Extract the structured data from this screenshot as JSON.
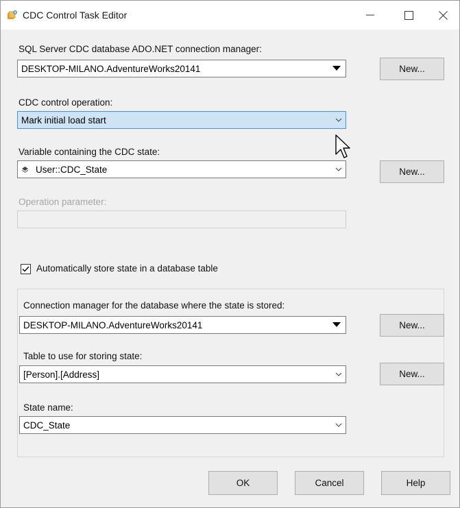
{
  "window": {
    "title": "CDC Control Task Editor"
  },
  "connection": {
    "label": "SQL Server CDC database ADO.NET connection manager:",
    "value": "DESKTOP-MILANO.AdventureWorks20141",
    "new_label": "New..."
  },
  "operation": {
    "label": "CDC control operation:",
    "value": "Mark initial load start"
  },
  "variable": {
    "label": "Variable containing the CDC state:",
    "value": "User::CDC_State",
    "new_label": "New..."
  },
  "parameter": {
    "label": "Operation parameter:",
    "value": ""
  },
  "auto_store": {
    "label": "Automatically store state in a database table",
    "checked": true
  },
  "state_connection": {
    "label": "Connection manager for the database where the state is stored:",
    "value": "DESKTOP-MILANO.AdventureWorks20141",
    "new_label": "New..."
  },
  "state_table": {
    "label": "Table to use for storing state:",
    "value": "[Person].[Address]",
    "new_label": "New..."
  },
  "state_name": {
    "label": "State name:",
    "value": "CDC_State"
  },
  "footer": {
    "ok_label": "OK",
    "cancel_label": "Cancel",
    "help_label": "Help"
  }
}
